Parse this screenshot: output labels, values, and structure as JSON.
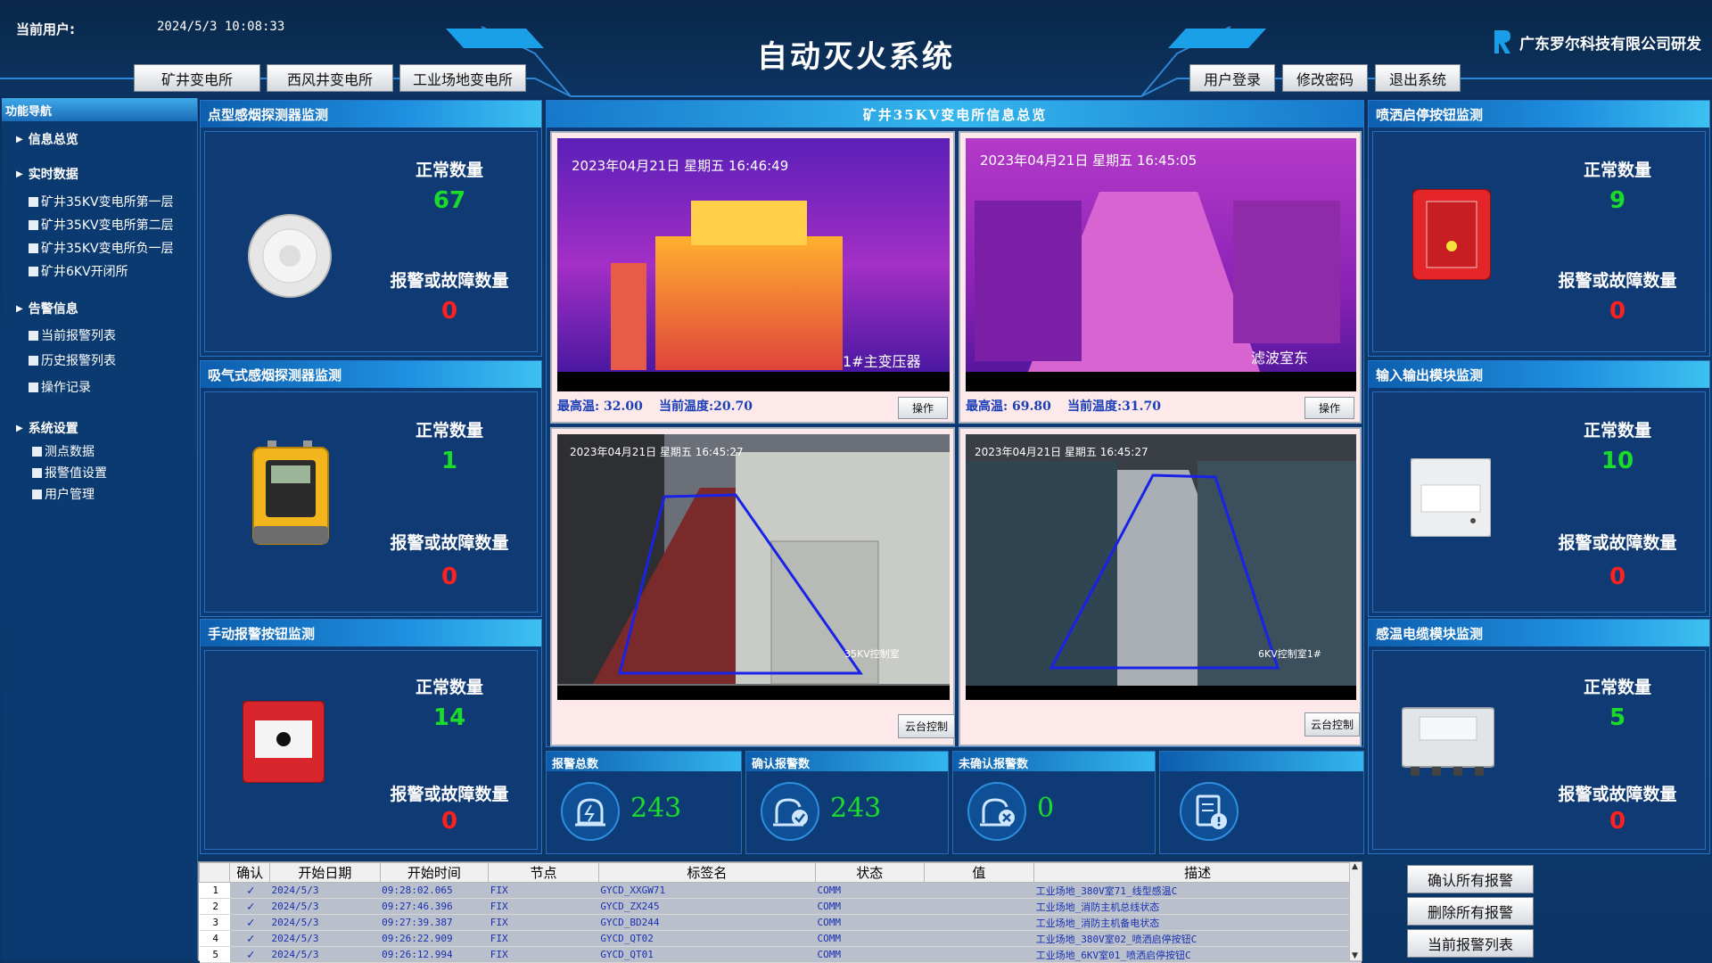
{
  "header": {
    "user_label": "当前用户:",
    "datetime": "2024/5/3  10:08:33",
    "title": "自动灭火系统",
    "company": "广东罗尔科技有限公司研发",
    "stations": [
      "矿井变电所",
      "西风井变电所",
      "工业场地变电所"
    ],
    "user_buttons": [
      "用户登录",
      "修改密码",
      "退出系统"
    ]
  },
  "nav": {
    "title": "功能导航",
    "info_overview": "信息总览",
    "realtime": "实时数据",
    "realtime_items": [
      "矿井35KV变电所第一层",
      "矿井35KV变电所第二层",
      "矿井35KV变电所负一层",
      "矿井6KV开闭所"
    ],
    "alarm": "告警信息",
    "alarm_items": [
      "当前报警列表",
      "历史报警列表",
      "操作记录"
    ],
    "settings": "系统设置",
    "settings_items": [
      "测点数据",
      "报警值设置",
      "用户管理"
    ]
  },
  "panels": {
    "normal_label": "正常数量",
    "fault_label": "报警或故障数量",
    "smoke": {
      "title": "点型感烟探测器监测",
      "normal": "67",
      "fault": "0"
    },
    "aspirating": {
      "title": "吸气式感烟探测器监测",
      "normal": "1",
      "fault": "0"
    },
    "manual": {
      "title": "手动报警按钮监测",
      "normal": "14",
      "fault": "0"
    },
    "spray": {
      "title": "喷洒启停按钮监测",
      "normal": "9",
      "fault": "0"
    },
    "io": {
      "title": "输入输出模块监测",
      "normal": "10",
      "fault": "0"
    },
    "cable": {
      "title": "感温电缆模块监测",
      "normal": "5",
      "fault": "0"
    }
  },
  "center": {
    "title": "矿井35KV变电所信息总览",
    "cam1": {
      "timestamp": "2023年04月21日  星期五  16:46:49",
      "caption": "1#主变压器",
      "max_temp": "最高温: 32.00",
      "cur_temp": "当前温度:20.70",
      "button": "操作"
    },
    "cam2": {
      "timestamp": "2023年04月21日  星期五  16:45:05",
      "caption": "滤波室东",
      "max_temp": "最高温: 69.80",
      "cur_temp": "当前温度:31.70",
      "button": "操作"
    },
    "cam3": {
      "timestamp": "2023年04月21日 星期五 16:45:27",
      "caption": "35KV控制室",
      "button": "云台控制"
    },
    "cam4": {
      "timestamp": "2023年04月21日 星期五 16:45:27",
      "caption": "6KV控制室1#",
      "button": "云台控制"
    }
  },
  "stats": {
    "total": {
      "label": "报警总数",
      "value": "243"
    },
    "confirmed": {
      "label": "确认报警数",
      "value": "243"
    },
    "unconfirmed": {
      "label": "未确认报警数",
      "value": "0"
    }
  },
  "table": {
    "headers": [
      "确认",
      "开始日期",
      "开始时间",
      "节点",
      "标签名",
      "状态",
      "值",
      "描述"
    ],
    "rows": [
      {
        "n": "1",
        "ck": "✓",
        "date": "2024/5/3",
        "time": "09:28:02.065",
        "node": "FIX",
        "tag": "GYCD_XXGW71",
        "state": "COMM",
        "value": "",
        "desc": "工业场地_380V室71_线型感温C"
      },
      {
        "n": "2",
        "ck": "✓",
        "date": "2024/5/3",
        "time": "09:27:46.396",
        "node": "FIX",
        "tag": "GYCD_ZX245",
        "state": "COMM",
        "value": "",
        "desc": "工业场地_消防主机总线状态"
      },
      {
        "n": "3",
        "ck": "✓",
        "date": "2024/5/3",
        "time": "09:27:39.387",
        "node": "FIX",
        "tag": "GYCD_BD244",
        "state": "COMM",
        "value": "",
        "desc": "工业场地_消防主机备电状态"
      },
      {
        "n": "4",
        "ck": "✓",
        "date": "2024/5/3",
        "time": "09:26:22.909",
        "node": "FIX",
        "tag": "GYCD_QT02",
        "state": "COMM",
        "value": "",
        "desc": "工业场地_380V室02_喷洒启停按钮C"
      },
      {
        "n": "5",
        "ck": "✓",
        "date": "2024/5/3",
        "time": "09:26:12.994",
        "node": "FIX",
        "tag": "GYCD_QT01",
        "state": "COMM",
        "value": "",
        "desc": "工业场地_6KV室01_喷洒启停按钮C"
      }
    ]
  },
  "right_buttons": [
    "确认所有报警",
    "删除所有报警",
    "当前报警列表"
  ]
}
